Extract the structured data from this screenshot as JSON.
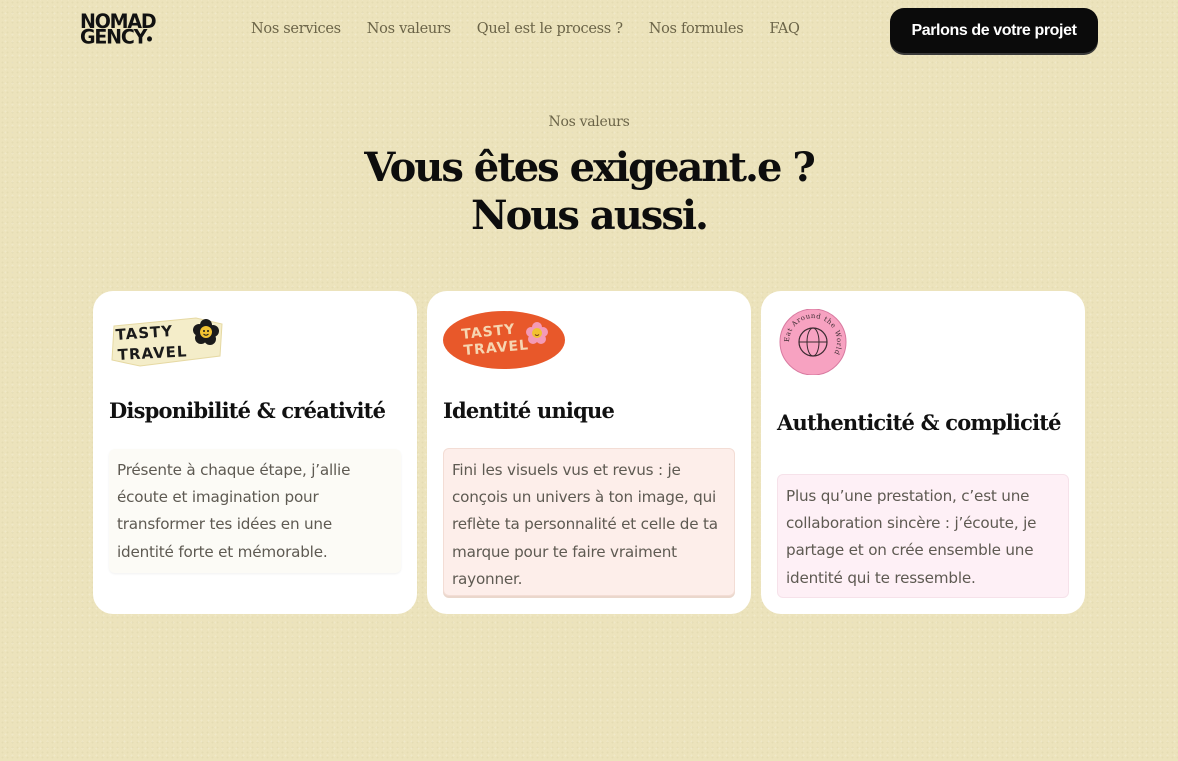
{
  "header": {
    "logo_line1": "NOMAD",
    "logo_line2": "GENCY",
    "nav": [
      "Nos services",
      "Nos valeurs",
      "Quel est le process ?",
      "Nos formules",
      "FAQ"
    ],
    "cta_label": "Parlons de votre projet"
  },
  "section": {
    "eyebrow": "Nos valeurs",
    "headline_line1": "Vous êtes exigeant.e ?",
    "headline_line2": "Nous aussi."
  },
  "cards": [
    {
      "title": "Disponibilité & créativité",
      "body": "Présente à chaque étape, j’allie écoute et imagination pour transformer tes idées en une identité forte et mémorable.",
      "sticker_line1": "TASTY",
      "sticker_line2": "TRAVEL"
    },
    {
      "title": "Identité unique",
      "body": "Fini les visuels vus et revus : je conçois un univers à ton image, qui reflète ta personnalité et celle de ta marque pour te faire vraiment rayonner.",
      "sticker_line1": "TASTY",
      "sticker_line2": "TRAVEL"
    },
    {
      "title": "Authenticité & complicité",
      "body": "Plus qu’une prestation, c’est une collaboration sincère : j’écoute, je partage et on crée ensemble une identité qui te ressemble.",
      "sticker_ring": "Eat Around the World",
      "sticker_center": "globe"
    }
  ],
  "colors": {
    "background": "#ece3bc",
    "nav_text": "#6b6448",
    "cta_bg": "#0b0b0b",
    "sticker_orange": "#e8582a",
    "sticker_pink": "#f7a2c1"
  }
}
